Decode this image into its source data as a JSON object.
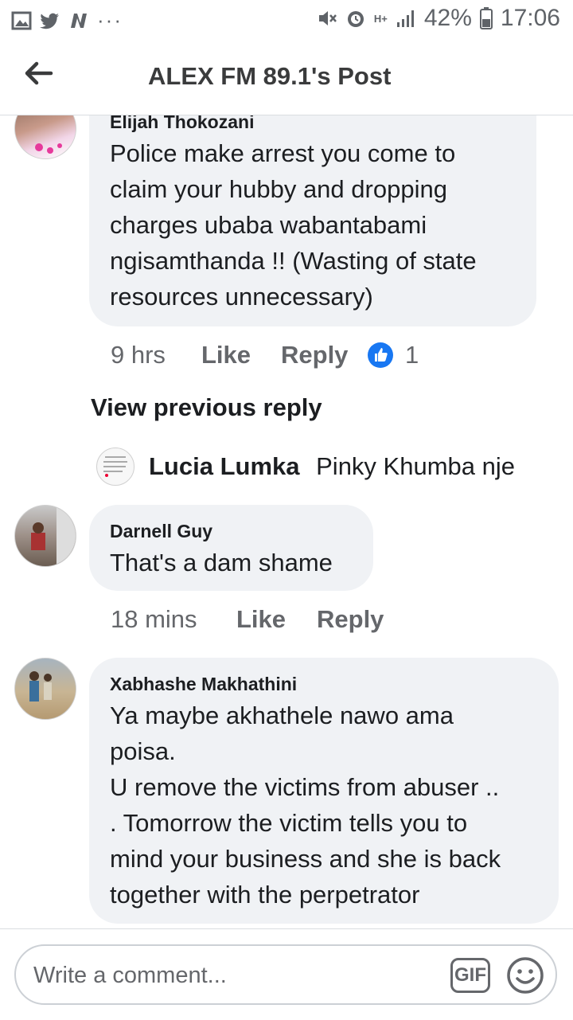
{
  "status_bar": {
    "battery": "42%",
    "time": "17:06",
    "network": "H+",
    "icons": [
      "gallery-icon",
      "twitter-icon",
      "news-icon",
      "more-dots-icon",
      "mute-icon",
      "alarm-icon",
      "signal-icon",
      "battery-icon"
    ]
  },
  "header": {
    "title": "ALEX FM 89.1's Post",
    "back_icon": "back-arrow-icon"
  },
  "comments": [
    {
      "name": "Elijah Thokozani",
      "text": "Police make arrest you come to claim your hubby and dropping charges ubaba wabantabami ngisamthanda !! (Wasting of state resources unnecessary)",
      "lines": [
        "Police make arrest you come to",
        "claim your hubby and dropping",
        "charges ubaba wabantabami",
        "ngisamthanda !! (Wasting of state",
        "resources unnecessary)"
      ],
      "time": "9 hrs",
      "like": "Like",
      "reply": "Reply",
      "reaction_count": "1"
    },
    {
      "view_previous": "View previous reply",
      "reply_name": "Lucia Lumka",
      "reply_text": "Pinky Khumba nje"
    },
    {
      "name": "Darnell Guy",
      "text": "That's a dam shame",
      "time": "18 mins",
      "like": "Like",
      "reply": "Reply"
    },
    {
      "name": "Xabhashe Makhathini",
      "lines": [
        "Ya maybe akhathele nawo ama",
        "poisa.",
        "U remove the victims from abuser ..",
        ". Tomorrow the victim tells you to",
        "mind your business and she is back",
        "together with the perpetrator"
      ]
    }
  ],
  "composer": {
    "placeholder": "Write a comment...",
    "gif": "GIF",
    "emoji_icon": "emoji-icon"
  },
  "colors": {
    "bubble": "#f0f2f5",
    "like_blue": "#1877f2",
    "meta_gray": "#65676b"
  }
}
